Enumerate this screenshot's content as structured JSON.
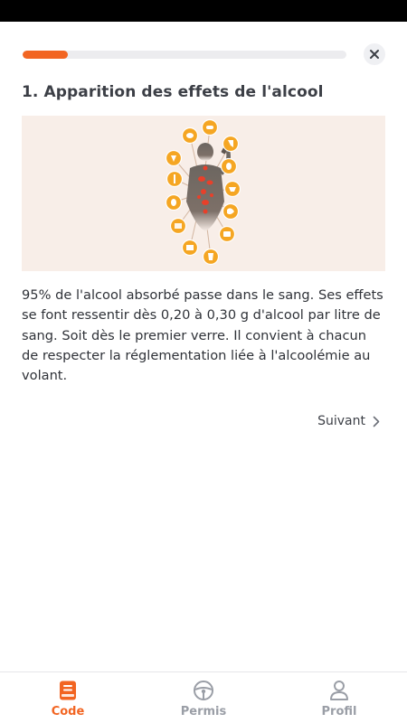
{
  "lesson": {
    "progress": 0.14,
    "title": "1. Apparition des effets de l'alcool",
    "body": "95% de l'alcool absorbé passe dans le sang. Ses effets se font ressentir dès 0,20 à 0,30 g d'alcool par litre de sang. Soit dès le premier verre. Il convient à chacun de respecter la réglementation liée à l'alcoolémie au volant.",
    "next_label": "Suivant",
    "illustration_icon": "drinking-person-organs-icon"
  },
  "nav": {
    "items": [
      {
        "label": "Code",
        "icon": "book-icon",
        "active": true
      },
      {
        "label": "Permis",
        "icon": "steering-wheel-icon",
        "active": false
      },
      {
        "label": "Profil",
        "icon": "person-icon",
        "active": false
      }
    ]
  },
  "colors": {
    "accent": "#f26522",
    "organ_circle": "#f5a623",
    "illustration_bg": "#f8eee8",
    "nav_inactive": "#9a9ea6"
  }
}
